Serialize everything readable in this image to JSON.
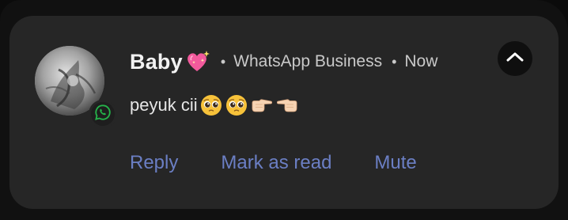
{
  "notification": {
    "sender": "Baby",
    "sender_emoji": "sparkling-heart-icon",
    "app_name": "WhatsApp Business",
    "separator": "•",
    "time": "Now",
    "message": "peyuk cii",
    "message_emojis": [
      "pleading-face-icon",
      "pleading-face-icon",
      "hand-pointing-right-icon",
      "hand-pointing-left-icon"
    ],
    "actions": {
      "reply": "Reply",
      "mark_as_read": "Mark as read",
      "mute": "Mute"
    },
    "colors": {
      "card_background": "#262626",
      "action_text": "#6b7fc4",
      "whatsapp_green": "#25b34a",
      "heart_pink": "#f25a9c"
    }
  }
}
